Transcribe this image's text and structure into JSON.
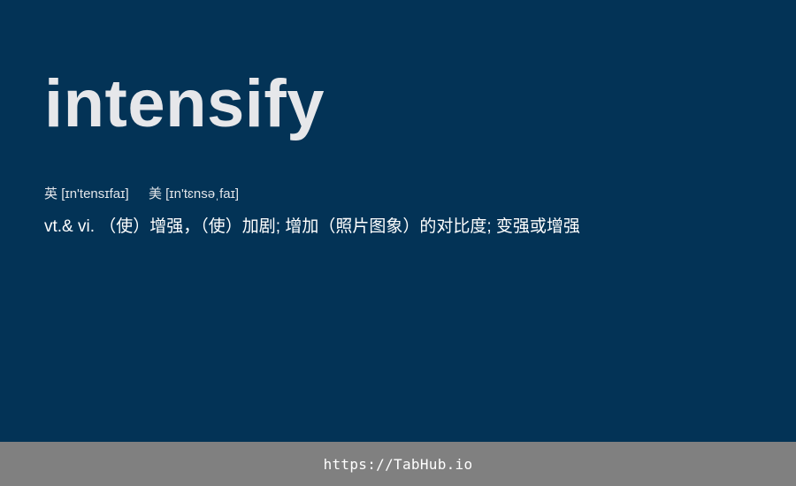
{
  "entry": {
    "word": "intensify",
    "phonetic_uk_label": "英",
    "phonetic_uk": "[ɪn'tensɪfaɪ]",
    "phonetic_us_label": "美",
    "phonetic_us": "[ɪn'tɛnsəˌfaɪ]",
    "definition": "vt.& vi. （使）增强，（使）加剧; 增加（照片图象）的对比度; 变强或增强"
  },
  "footer": {
    "link_text": "https://TabHub.io"
  },
  "colors": {
    "background": "#033356",
    "footer_background": "#808080",
    "word_text": "#e6e7ea",
    "body_text": "#ffffff"
  }
}
